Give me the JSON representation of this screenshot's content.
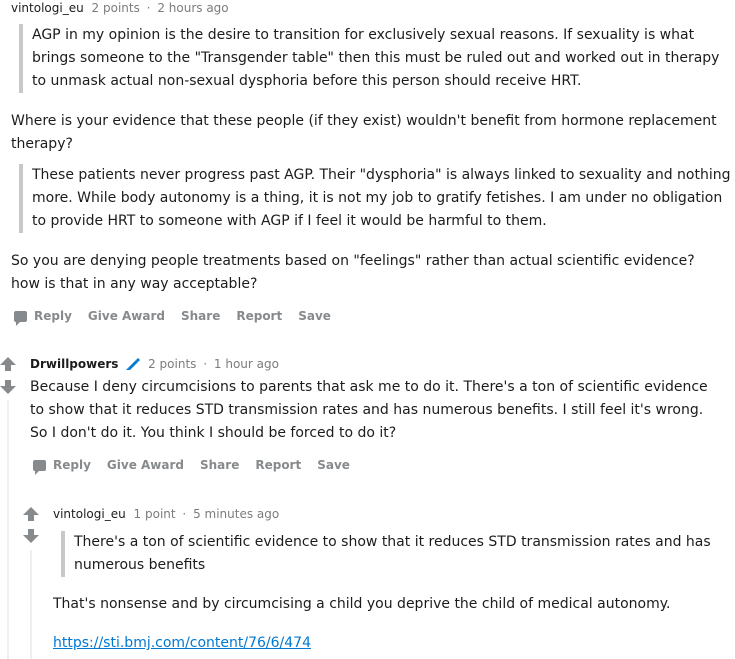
{
  "comment1": {
    "author": "vintologi_eu",
    "points": "2 points",
    "time": "2 hours ago",
    "quote1": "AGP in my opinion is the desire to transition for exclusively sexual reasons. If sexuality is what brings someone to the \"Transgender table\" then this must be ruled out and worked out in therapy to unmask actual non-sexual dysphoria before this person should receive HRT.",
    "para1": "Where is your evidence that these people (if they exist) wouldn't benefit from hormone replacement therapy?",
    "quote2": "These patients never progress past AGP. Their \"dysphoria\" is always linked to sexuality and nothing more. While body autonomy is a thing, it is not my job to gratify fetishes. I am under no obligation to provide HRT to someone with AGP if I feel it would be harmful to them.",
    "para2": "So you are denying people treatments based on \"feelings\" rather than actual scientific evidence? how is that in any way acceptable?"
  },
  "comment2": {
    "author": "Drwillpowers",
    "flair_icon": "pencil-icon",
    "points": "2 points",
    "time": "1 hour ago",
    "body": "Because I deny circumcisions to parents that ask me to do it. There's a ton of scientific evidence to show that it reduces STD transmission rates and has numerous benefits. I still feel it's wrong. So I don't do it. You think I should be forced to do it?"
  },
  "comment3": {
    "author": "vintologi_eu",
    "points": "1 point",
    "time": "5 minutes ago",
    "quote": "There's a ton of scientific evidence to show that it reduces STD transmission rates and has numerous benefits",
    "para": "That's nonsense and by circumcising a child you deprive the child of medical autonomy.",
    "link": "https://sti.bmj.com/content/76/6/474"
  },
  "actions": {
    "reply": "Reply",
    "give_award": "Give Award",
    "share": "Share",
    "report": "Report",
    "save": "Save"
  },
  "colors": {
    "link": "#0079d3",
    "meta": "#7c7c7c",
    "action": "#878a8c",
    "quote_border": "#c8c8c8",
    "thread_line": "#edeff1"
  }
}
